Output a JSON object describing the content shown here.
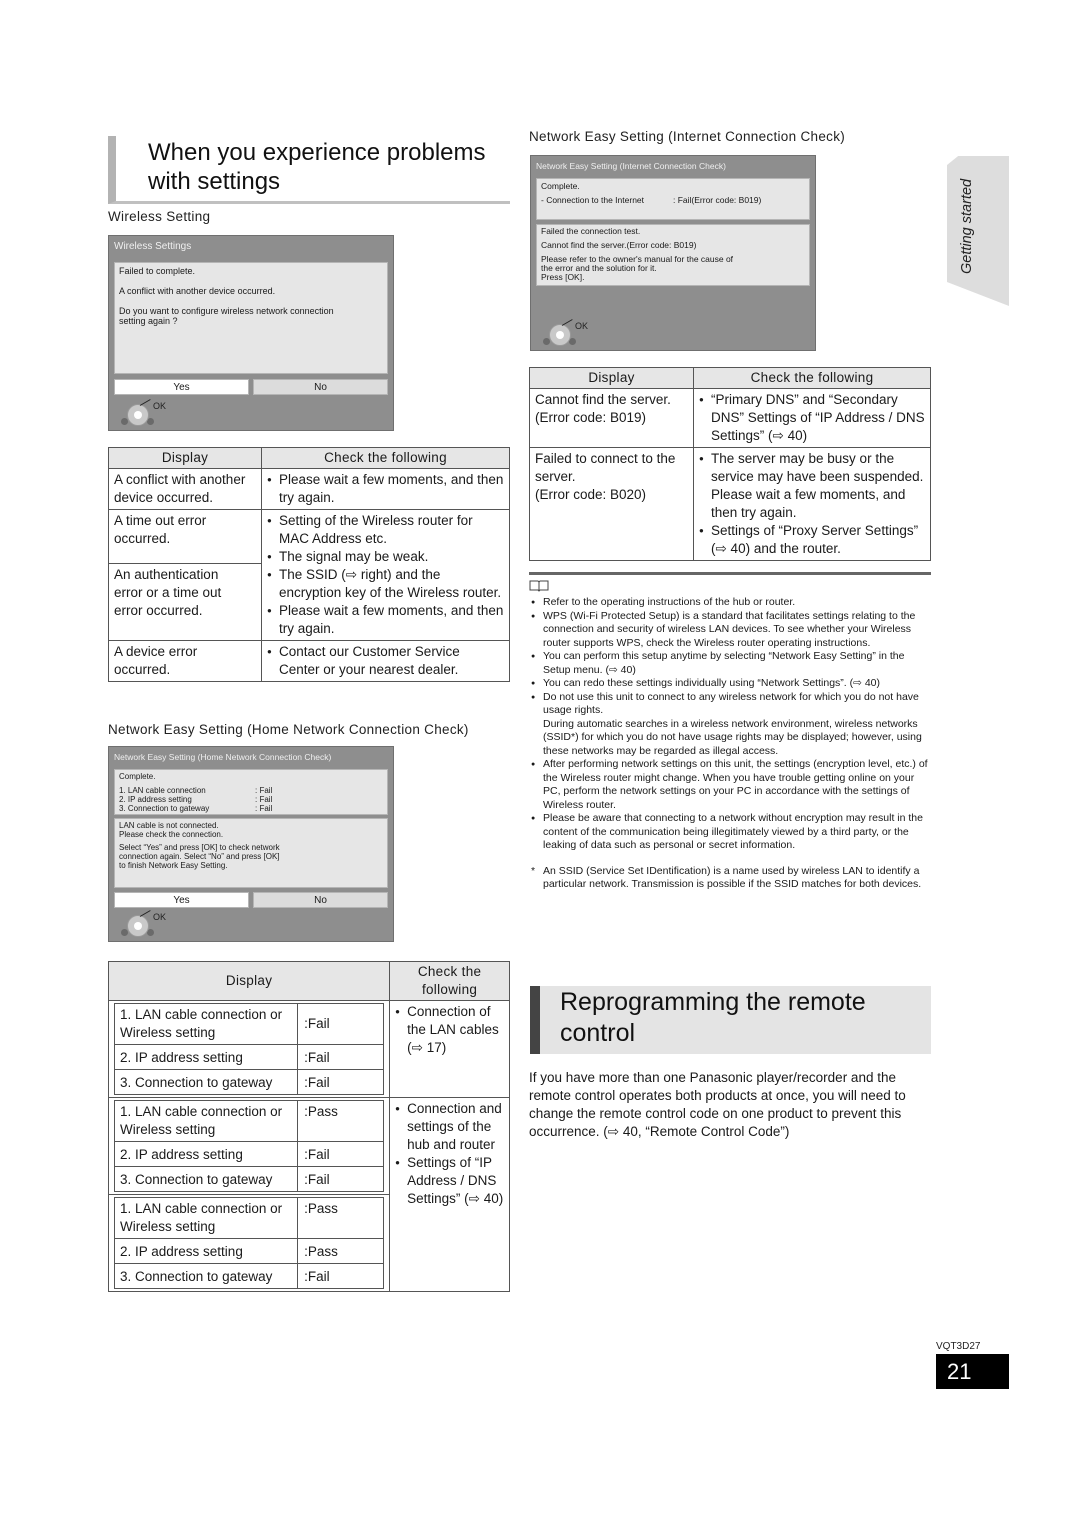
{
  "left_section": {
    "title_line1": "When you experience problems",
    "title_line2": "with settings",
    "wireless": {
      "caption": "Wireless Setting",
      "screen": {
        "title": "Wireless Settings",
        "lines": [
          "Failed to complete.",
          "A conflict with another device occurred.",
          "Do you want to configure wireless network connection",
          "setting again ?"
        ],
        "yes": "Yes",
        "no": "No",
        "ok": "OK"
      },
      "table": {
        "headers": [
          "Display",
          "Check the following"
        ],
        "rows": [
          {
            "display": [
              "A conflict with another",
              "device occurred."
            ],
            "checks": [
              "Please wait a few moments, and then try again."
            ]
          },
          {
            "display": [
              "A time out error",
              "occurred."
            ]
          },
          {
            "display": [
              "An authentication",
              "error or a time out",
              "error occurred."
            ]
          },
          {
            "display": [
              "A device error",
              "occurred."
            ],
            "checks": [
              "Contact our Customer Service Center or your nearest dealer."
            ]
          }
        ],
        "shared_checks": [
          "Setting of the Wireless router for MAC Address etc.",
          "The signal may be weak.",
          "The SSID (⇨ right) and the encryption key of the Wireless router.",
          "Please wait a few moments, and then try again."
        ]
      }
    },
    "home_network": {
      "caption": "Network Easy Setting (Home Network Connection Check)",
      "screen": {
        "title": "Network Easy Setting (Home Network Connection Check)",
        "complete": "Complete.",
        "items": [
          {
            "label": "1. LAN cable connection",
            "value": ": Fail"
          },
          {
            "label": "2. IP address setting",
            "value": ": Fail"
          },
          {
            "label": "3. Connection to gateway",
            "value": ": Fail"
          }
        ],
        "msg1": "LAN cable is not connected.",
        "msg2": "Please check the connection.",
        "msg3": "Select “Yes” and press [OK] to check network",
        "msg4": "connection again. Select “No” and press [OK]",
        "msg5": "to finish Network Easy Setting.",
        "yes": "Yes",
        "no": "No",
        "ok": "OK"
      },
      "table": {
        "headers": [
          "Display",
          "Check the following"
        ],
        "groups": [
          {
            "rows": [
              {
                "label": "1. LAN cable connection or Wireless setting",
                "value": ":Fail"
              },
              {
                "label": "2. IP address setting",
                "value": ":Fail"
              },
              {
                "label": "3. Connection to gateway",
                "value": ":Fail"
              }
            ]
          },
          {
            "rows": [
              {
                "label": "1. LAN cable connection or Wireless setting",
                "value": ":Pass"
              },
              {
                "label": "2. IP address setting",
                "value": ":Fail"
              },
              {
                "label": "3. Connection to gateway",
                "value": ":Fail"
              }
            ]
          },
          {
            "rows": [
              {
                "label": "1. LAN cable connection or Wireless setting",
                "value": ":Pass"
              },
              {
                "label": "2. IP address setting",
                "value": ":Pass"
              },
              {
                "label": "3. Connection to gateway",
                "value": ":Fail"
              }
            ]
          }
        ],
        "check1": "Connection of the LAN cables (⇨ 17)",
        "check2a": "Connection and settings of the hub and router",
        "check2b": "Settings of “IP Address / DNS Settings” (⇨ 40)"
      }
    }
  },
  "right_section": {
    "internet": {
      "caption": "Network Easy Setting (Internet Connection Check)",
      "screen": {
        "title": "Network Easy Setting (Internet Connection Check)",
        "complete": "Complete.",
        "item_label": "- Connection to the Internet",
        "item_value": ":   Fail(Error code: B019)",
        "msg1": "Failed the connection test.",
        "msg2": "Cannot find the server.(Error code: B019)",
        "msg3": "Please refer to the owner's manual for the cause of",
        "msg4": "the error and the solution for it.",
        "msg5": "Press [OK].",
        "ok": "OK"
      },
      "table": {
        "headers": [
          "Display",
          "Check the following"
        ],
        "rows": [
          {
            "display": [
              "Cannot find the server.",
              "(Error code: B019)"
            ],
            "checks": [
              "“Primary DNS” and “Secondary DNS” Settings of “IP Address / DNS Settings” (⇨ 40)"
            ]
          },
          {
            "display": [
              "Failed to connect to the",
              "server.",
              "(Error code: B020)"
            ],
            "checks": [
              "The server may be busy or the service may have been suspended. Please wait a few moments, and then try again.",
              "Settings of “Proxy Server Settings” (⇨ 40) and the router."
            ]
          }
        ]
      }
    },
    "notes": [
      "Refer to the operating instructions of the hub or router.",
      "WPS (Wi-Fi Protected Setup) is a standard that facilitates settings relating to the connection and security of wireless LAN devices. To see whether your Wireless router supports WPS, check the Wireless router operating instructions.",
      "You can perform this setup anytime by selecting “Network Easy Setting” in the Setup menu. (⇨ 40)",
      "You can redo these settings individually using “Network Settings”. (⇨ 40)",
      "Do not use this unit to connect to any wireless network for which you do not have usage rights.",
      "After performing network settings on this unit, the settings (encryption level, etc.) of the Wireless router might change. When you have trouble getting online on your PC, perform the network settings on your PC in accordance with the settings of Wireless router.",
      "Please be aware that connecting to a network without encryption may result in the content of the communication being illegitimately viewed by a third party, or the leaking of data such as personal or secret information."
    ],
    "note_4_extra": "During automatic searches in a wireless network environment, wireless networks (SSID*) for which you do not have usage rights may be displayed; however, using these networks may be regarded as illegal access.",
    "footnote_mark": "*",
    "footnote": "An SSID (Service Set IDentification) is a name used by wireless LAN to identify a particular network. Transmission is possible if the SSID matches for both devices.",
    "remote": {
      "title_line1": "Reprogramming the remote",
      "title_line2": "control",
      "body": "If you have more than one Panasonic player/recorder and the remote control operates both products at once, you will need to change the remote control code on one product to prevent this occurrence. (⇨ 40, “Remote Control Code”)"
    }
  },
  "side_tab": "Getting started",
  "footer": {
    "doc_code": "VQT3D27",
    "page_number": "21"
  }
}
